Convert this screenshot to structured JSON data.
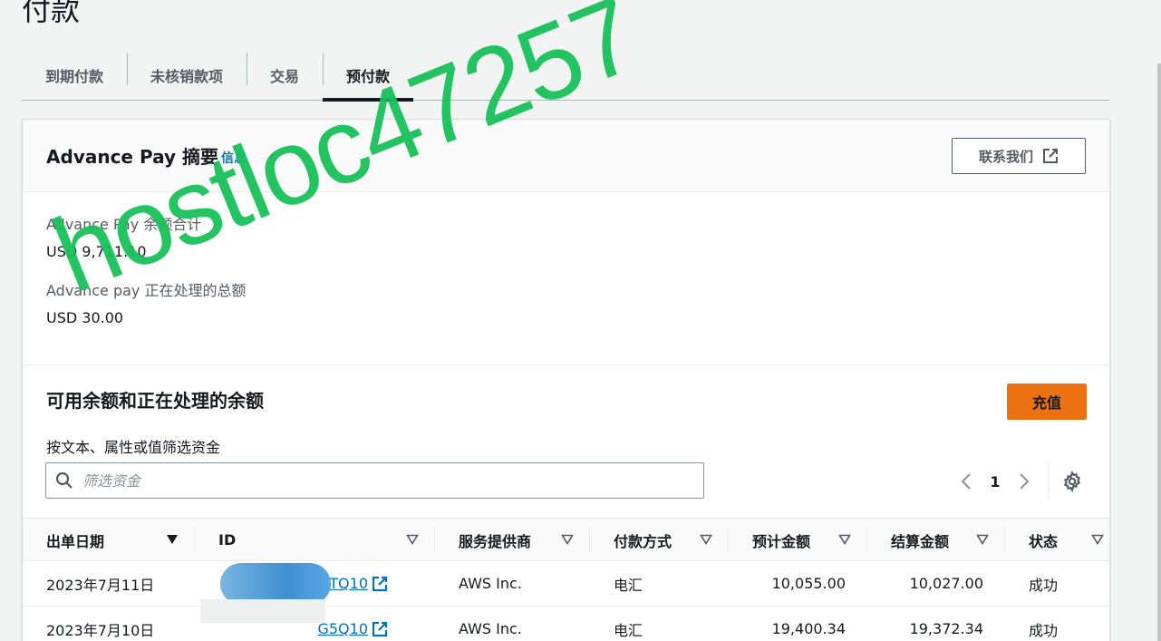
{
  "page": {
    "title": "付款"
  },
  "tabs": [
    {
      "label": "到期付款"
    },
    {
      "label": "未核销款项"
    },
    {
      "label": "交易"
    },
    {
      "label": "预付款"
    }
  ],
  "summary": {
    "title": "Advance Pay 摘要",
    "info_link": "信息",
    "contact_button": "联系我们",
    "balance_label": "Advance Pay 余额合计",
    "balance_value": "USD 9,711.10",
    "processing_label": "Advance pay 正在处理的总额",
    "processing_value": "USD 30.00"
  },
  "funds": {
    "title": "可用余额和正在处理的余额",
    "recharge_button": "充值",
    "filter_label": "按文本、属性或值筛选资金",
    "filter_placeholder": "筛选资金",
    "page_number": "1"
  },
  "table": {
    "columns": [
      "出单日期",
      "ID",
      "服务提供商",
      "付款方式",
      "预计金额",
      "结算金额",
      "状态"
    ],
    "rows": [
      {
        "date": "2023年7月11日",
        "id": "I2TQ10",
        "provider": "AWS Inc.",
        "method": "电汇",
        "estimated": "10,055.00",
        "settled": "10,027.00",
        "status": "成功"
      },
      {
        "date": "2023年7月10日",
        "id": "G5Q10",
        "provider": "AWS Inc.",
        "method": "电汇",
        "estimated": "19,400.34",
        "settled": "19,372.34",
        "status": "成功"
      }
    ]
  },
  "watermark": "hostloc47257",
  "colors": {
    "accent": "#ec7211",
    "link": "#0073bb",
    "watermark": "#19c15a"
  }
}
